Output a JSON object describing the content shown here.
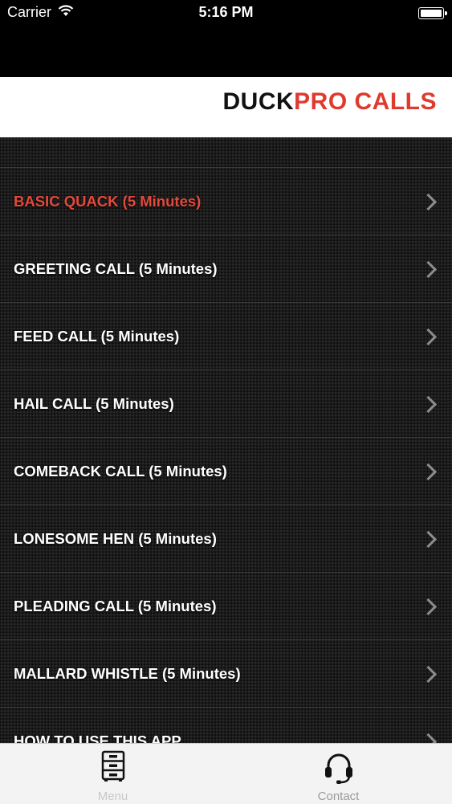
{
  "status_bar": {
    "carrier": "Carrier",
    "time": "5:16 PM"
  },
  "header": {
    "brand_duck": "DUCK",
    "brand_pro_calls": "PRO CALLS",
    "brand_colors": {
      "duck": "#111111",
      "pro_calls": "#e03a2f"
    }
  },
  "menu": {
    "items": [
      {
        "label": "BASIC QUACK (5 Minutes)",
        "active": true
      },
      {
        "label": "GREETING CALL (5 Minutes)"
      },
      {
        "label": "FEED CALL (5 Minutes)"
      },
      {
        "label": "HAIL CALL (5 Minutes)"
      },
      {
        "label": "COMEBACK CALL (5 Minutes)"
      },
      {
        "label": "LONESOME HEN (5 Minutes)"
      },
      {
        "label": "PLEADING CALL (5 Minutes)"
      },
      {
        "label": "MALLARD WHISTLE (5 Minutes)"
      },
      {
        "label": "HOW TO USE THIS APP"
      }
    ]
  },
  "tab_bar": {
    "tabs": [
      {
        "label": "Menu",
        "icon": "drawer-cabinet-icon",
        "selected": true
      },
      {
        "label": "Contact",
        "icon": "headset-icon",
        "selected": false
      }
    ]
  }
}
